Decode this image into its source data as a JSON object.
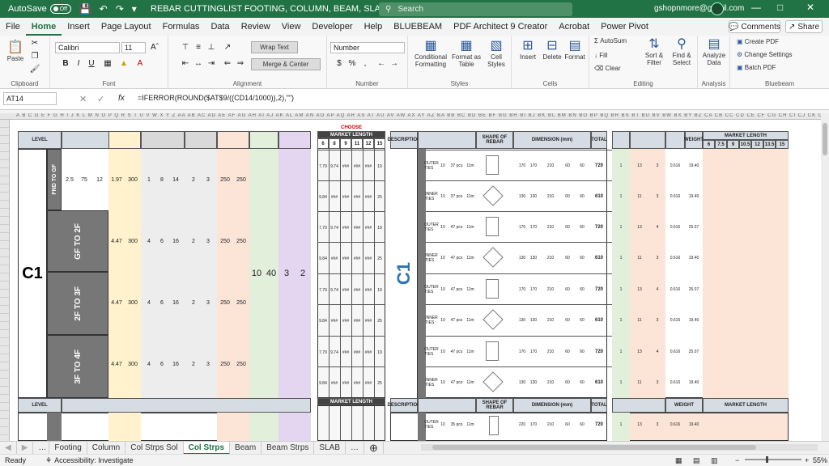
{
  "titlebar": {
    "autosave_label": "AutoSave",
    "autosave_state": "Off",
    "doc_title": "REBAR CUTTINGLIST FOOTING, COLUMN, BEAM, SLAB AND STIRRUPS",
    "search_placeholder": "Search",
    "account": "gshopnmore@gmail.com"
  },
  "menu": {
    "items": [
      "File",
      "Home",
      "Insert",
      "Page Layout",
      "Formulas",
      "Data",
      "Review",
      "View",
      "Developer",
      "Help",
      "BLUEBEAM",
      "PDF Architect 9 Creator",
      "Acrobat",
      "Power Pivot"
    ],
    "comments": "Comments",
    "share": "Share"
  },
  "ribbon": {
    "clipboard": {
      "label": "Clipboard",
      "paste": "Paste"
    },
    "font": {
      "label": "Font",
      "name": "Calibri",
      "size": "11",
      "bold": "B",
      "italic": "I",
      "underline": "U"
    },
    "alignment": {
      "label": "Alignment",
      "wrap": "Wrap Text",
      "merge": "Merge & Center"
    },
    "number": {
      "label": "Number",
      "format": "Number"
    },
    "styles": {
      "label": "Styles",
      "conditional": "Conditional Formatting",
      "format_table": "Format as Table",
      "cell_styles": "Cell Styles"
    },
    "cells": {
      "label": "Cells",
      "insert": "Insert",
      "delete": "Delete",
      "format": "Format"
    },
    "editing": {
      "label": "Editing",
      "autosum": "AutoSum",
      "fill": "Fill",
      "clear": "Clear",
      "sort": "Sort & Filter",
      "find": "Find & Select"
    },
    "analysis": {
      "label": "Analysis",
      "analyze": "Analyze Data"
    },
    "bluebeam": {
      "label": "Bluebeam",
      "create": "Create PDF",
      "settings": "Change Settings",
      "batch": "Batch PDF"
    }
  },
  "formula_bar": {
    "cell": "AT14",
    "fx": "fx",
    "formula": "=IFERROR(ROUND($AT$9/((CD14/1000)),2),\"\")"
  },
  "sheet": {
    "level_header": "LEVEL",
    "column_id": "C1",
    "levels": [
      "FND TO GF",
      "GF TO 2F",
      "2F TO 3F",
      "3F TO 4F"
    ],
    "footing_row": [
      "2.5",
      "75",
      "12",
      "1.97",
      "300",
      "1",
      "8",
      "14",
      "2",
      "3",
      "250",
      "250"
    ],
    "level_rows": [
      [
        "4.47",
        "300",
        "4",
        "6",
        "16",
        "2",
        "3",
        "250",
        "250"
      ],
      [
        "4.47",
        "300",
        "4",
        "6",
        "16",
        "2",
        "3",
        "250",
        "250"
      ],
      [
        "4.47",
        "300",
        "4",
        "6",
        "16",
        "2",
        "3",
        "250",
        "250"
      ]
    ],
    "merged_values": [
      "10",
      "40",
      "3",
      "2"
    ],
    "market_length_title": "MARKET LENGTH",
    "choose": "CHOOSE",
    "market_lengths": [
      "6",
      "8",
      "9",
      "11",
      "12",
      "15"
    ],
    "ml_rows": [
      [
        "7.79",
        "9.74",
        "###",
        "###",
        "###",
        "19"
      ],
      [
        "9.84",
        "###",
        "###",
        "###",
        "###",
        "25"
      ],
      [
        "7.79",
        "9.74",
        "###",
        "###",
        "###",
        "19"
      ],
      [
        "9.84",
        "###",
        "###",
        "###",
        "###",
        "25"
      ],
      [
        "7.79",
        "9.74",
        "###",
        "###",
        "###",
        "19"
      ],
      [
        "9.84",
        "###",
        "###",
        "###",
        "###",
        "25"
      ],
      [
        "7.79",
        "9.74",
        "###",
        "###",
        "###",
        "19"
      ],
      [
        "9.84",
        "###",
        "###",
        "###",
        "###",
        "25"
      ]
    ],
    "description": "DESCRIPTION",
    "shape_header": "SHAPE OF REBAR",
    "dimension_header": "DIMENSION (mm)",
    "total_header": "TOTAL",
    "stirrup_rows": [
      {
        "type": "OUTER TIES",
        "dia": "10",
        "count": "37 pcs",
        "len": "11m",
        "a": "170",
        "b": "170",
        "c": "210",
        "d": "60",
        "e": "60",
        "total": "720",
        "sets": "1",
        "n1": "13",
        "n2": "3",
        "w": "0.616",
        "wt": "19.40"
      },
      {
        "type": "INNER TIES",
        "dia": "10",
        "count": "37 pcs",
        "len": "11m",
        "a": "130",
        "b": "130",
        "c": "210",
        "d": "60",
        "e": "60",
        "total": "610",
        "sets": "1",
        "n1": "11",
        "n2": "3",
        "w": "0.616",
        "wt": "19.40"
      },
      {
        "type": "OUTER TIES",
        "dia": "10",
        "count": "47 pcs",
        "len": "11m",
        "a": "170",
        "b": "170",
        "c": "210",
        "d": "60",
        "e": "60",
        "total": "720",
        "sets": "1",
        "n1": "13",
        "n2": "4",
        "w": "0.616",
        "wt": "25.07"
      },
      {
        "type": "INNER TIES",
        "dia": "10",
        "count": "47 pcs",
        "len": "11m",
        "a": "130",
        "b": "130",
        "c": "210",
        "d": "60",
        "e": "60",
        "total": "610",
        "sets": "1",
        "n1": "11",
        "n2": "3",
        "w": "0.616",
        "wt": "19.40"
      },
      {
        "type": "OUTER TIES",
        "dia": "10",
        "count": "47 pcs",
        "len": "11m",
        "a": "170",
        "b": "170",
        "c": "210",
        "d": "60",
        "e": "60",
        "total": "720",
        "sets": "1",
        "n1": "13",
        "n2": "4",
        "w": "0.616",
        "wt": "25.07"
      },
      {
        "type": "INNER TIES",
        "dia": "10",
        "count": "47 pcs",
        "len": "11m",
        "a": "130",
        "b": "130",
        "c": "210",
        "d": "60",
        "e": "60",
        "total": "610",
        "sets": "1",
        "n1": "11",
        "n2": "3",
        "w": "0.616",
        "wt": "19.40"
      },
      {
        "type": "OUTER TIES",
        "dia": "10",
        "count": "47 pcs",
        "len": "11m",
        "a": "170",
        "b": "170",
        "c": "210",
        "d": "60",
        "e": "60",
        "total": "720",
        "sets": "1",
        "n1": "13",
        "n2": "4",
        "w": "0.616",
        "wt": "25.07"
      },
      {
        "type": "INNER TIES",
        "dia": "10",
        "count": "47 pcs",
        "len": "11m",
        "a": "130",
        "b": "130",
        "c": "210",
        "d": "60",
        "e": "60",
        "total": "610",
        "sets": "1",
        "n1": "11",
        "n2": "3",
        "w": "0.616",
        "wt": "19.40"
      }
    ],
    "weight_header": "WEIGHT",
    "market_header_right": "MARKET LENGTH",
    "right_lengths": [
      "6",
      "7.5",
      "9",
      "10.5",
      "12",
      "13.5",
      "15"
    ],
    "bottom_row": {
      "type": "OUTER TIES",
      "dia": "10",
      "count": "35 pcs",
      "len": "11m",
      "a": "220",
      "b": "170",
      "c": "210",
      "d": "60",
      "e": "60",
      "total": "720",
      "sets": "1",
      "n1": "13",
      "n2": "3",
      "w": "0.616",
      "wt": "19.40"
    }
  },
  "tabs": [
    "Footing",
    "Column",
    "Col Strps Sol",
    "Col Strps",
    "Beam",
    "Beam Strps",
    "SLAB"
  ],
  "active_tab": "Col Strps",
  "status": {
    "ready": "Ready",
    "accessibility": "Accessibility: Investigate",
    "zoom": "55%"
  },
  "colors": {
    "accent": "#217346",
    "footing_blue": "#2e75b6",
    "level_grey": "#777777"
  }
}
